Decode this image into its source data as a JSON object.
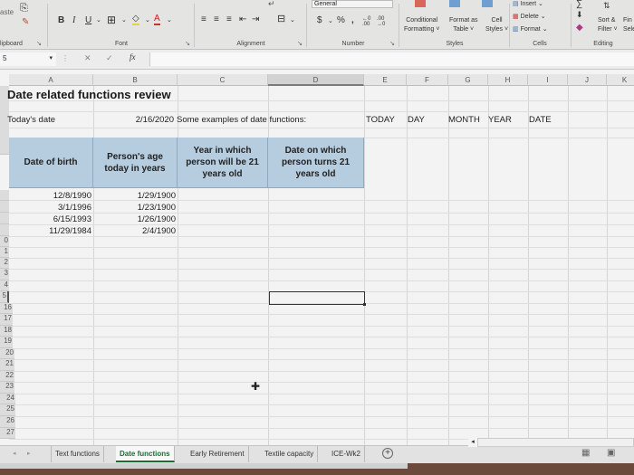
{
  "ribbon": {
    "clipboard": {
      "paste_label": "aste",
      "group_label": "lipboard"
    },
    "font": {
      "group_label": "Font",
      "bold": "B",
      "italic": "I",
      "underline": "U",
      "font_color_glyph": "A"
    },
    "alignment": {
      "group_label": "Alignment"
    },
    "number": {
      "group_label": "Number",
      "format_value": "General",
      "currency": "$",
      "percent": "%",
      "comma": ")",
      "increase_decimal": "←.0 .00",
      "decrease_decimal": ".00 →.0"
    },
    "styles": {
      "group_label": "Styles",
      "conditional_formatting": [
        "Conditional",
        "Formatting ˅"
      ],
      "format_as_table": [
        "Format as",
        "Table ˅"
      ],
      "cell_styles": [
        "Cell",
        "Styles ˅"
      ]
    },
    "cells": {
      "group_label": "Cells",
      "insert": "Insert",
      "delete": "Delete",
      "format": "Format"
    },
    "editing": {
      "group_label": "Editing",
      "sort_filter": [
        "Sort &",
        "Filter ˅"
      ],
      "find_select": [
        "Fin",
        "Sele"
      ]
    }
  },
  "formula_bar": {
    "name_box": "5",
    "cancel": "✕",
    "enter": "✓",
    "fx": "fx",
    "value": ""
  },
  "columns": [
    "A",
    "B",
    "C",
    "D",
    "E",
    "F",
    "G",
    "H",
    "I",
    "J",
    "K"
  ],
  "selected_column": "D",
  "rows": {
    "visible_numbers": [
      "",
      "",
      "",
      "",
      "",
      "",
      "",
      "",
      "",
      "0",
      "1",
      "2",
      "3",
      "4",
      "5",
      "16",
      "17",
      "18",
      "19",
      "20",
      "21",
      "22",
      "23",
      "24",
      "25",
      "26",
      "27"
    ]
  },
  "sheet": {
    "title": "Date related functions review",
    "todays_date_label": "Today's date",
    "todays_date_value": "2/16/2020",
    "examples_label": "Some examples of date functions:",
    "function_names": [
      "TODAY",
      "DAY",
      "MONTH",
      "YEAR",
      "DATE"
    ],
    "table": {
      "headers": [
        "Date of birth",
        "Person's age today in years",
        "Year in which person will be 21 years old",
        "Date on which person turns 21 years old"
      ],
      "rows": [
        [
          "12/8/1990",
          "1/29/1900",
          "",
          ""
        ],
        [
          "3/1/1996",
          "1/23/1900",
          "",
          ""
        ],
        [
          "6/15/1993",
          "1/26/1900",
          "",
          ""
        ],
        [
          "11/29/1984",
          "2/4/1900",
          "",
          ""
        ]
      ]
    }
  },
  "tabs": [
    {
      "label": "Text functions",
      "active": false
    },
    {
      "label": "Date functions",
      "active": true
    },
    {
      "label": "Early Retirement",
      "active": false
    },
    {
      "label": "Textile capacity",
      "active": false
    },
    {
      "label": "ICE-Wk2",
      "active": false
    }
  ],
  "tab_add": "+",
  "colors": {
    "header_fill": "#b6cde0",
    "active_tab_text": "#1d6b3a",
    "selection_border": "#333333"
  }
}
